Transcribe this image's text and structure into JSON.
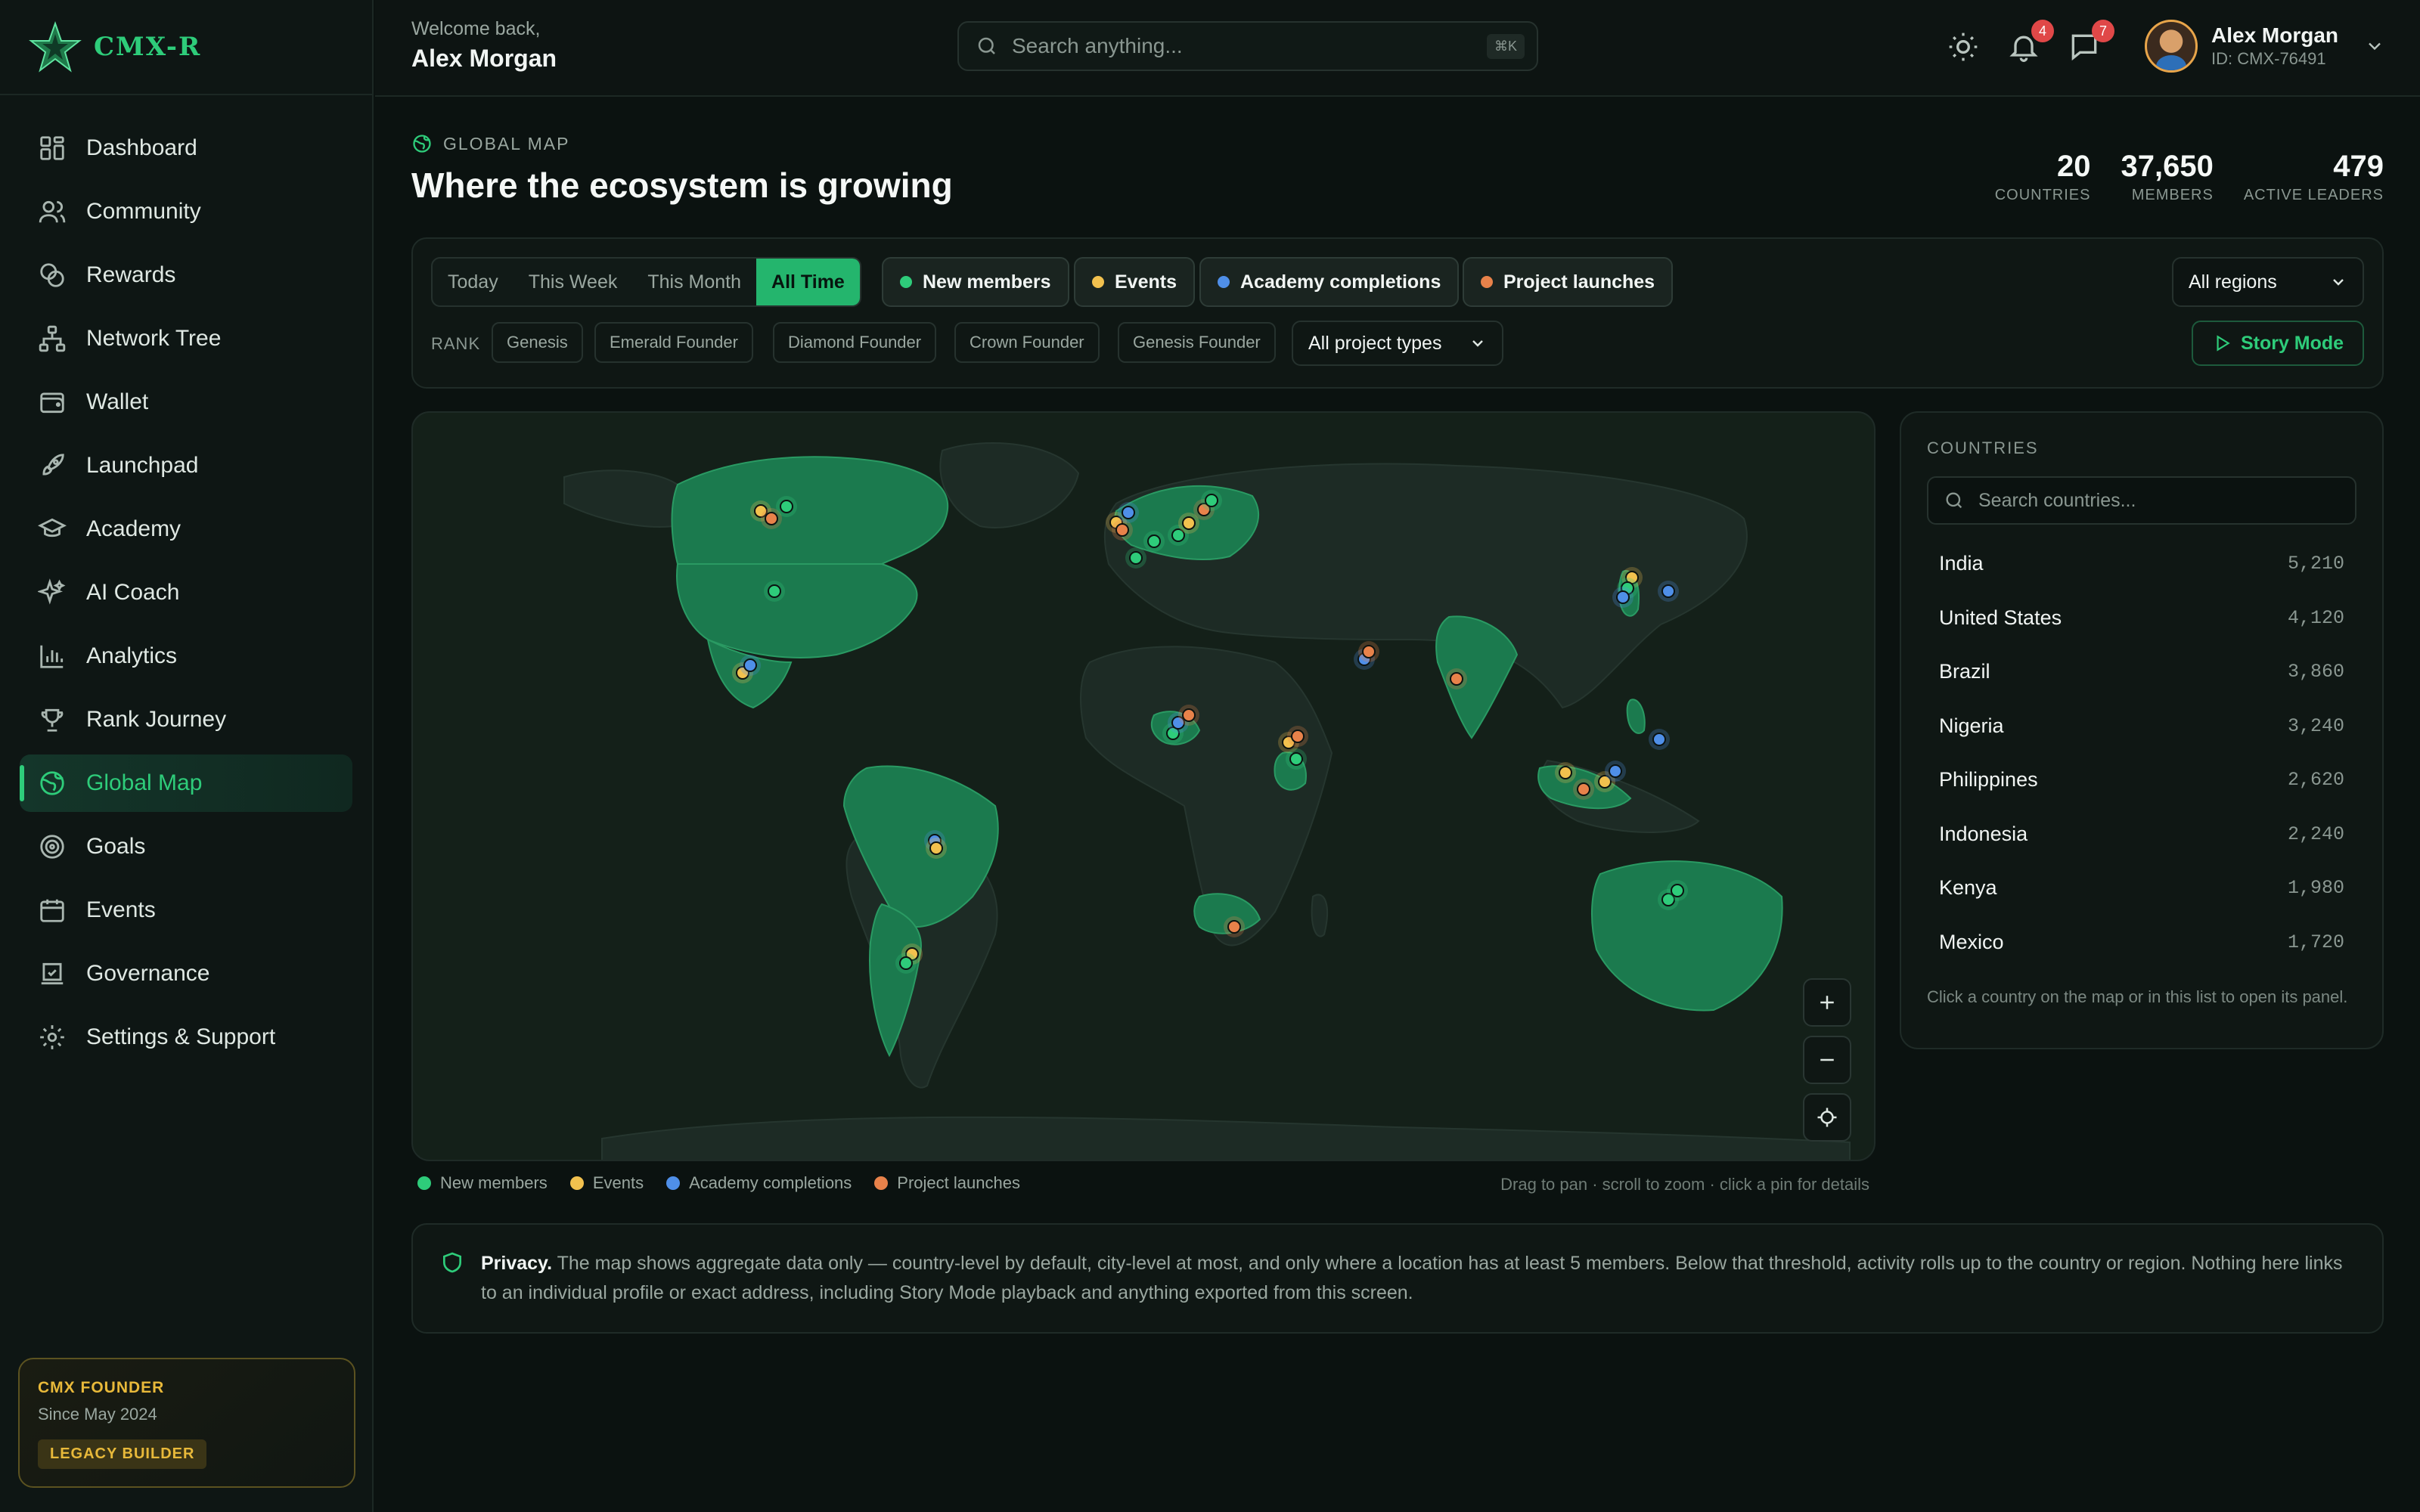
{
  "brand": {
    "name": "CMX-R",
    "accent": "#2ecc7a"
  },
  "header": {
    "welcome": "Welcome back,",
    "user_name": "Alex Morgan",
    "search_placeholder": "Search anything...",
    "search_shortcut": "⌘K",
    "notifications_count": "4",
    "messages_count": "7",
    "user_id": "ID: CMX-76491"
  },
  "sidebar": {
    "items": [
      {
        "label": "Dashboard",
        "icon": "dashboard-icon"
      },
      {
        "label": "Community",
        "icon": "users-icon"
      },
      {
        "label": "Rewards",
        "icon": "coins-icon"
      },
      {
        "label": "Network Tree",
        "icon": "network-icon"
      },
      {
        "label": "Wallet",
        "icon": "wallet-icon"
      },
      {
        "label": "Launchpad",
        "icon": "rocket-icon"
      },
      {
        "label": "Academy",
        "icon": "graduation-cap-icon"
      },
      {
        "label": "AI Coach",
        "icon": "sparkles-icon"
      },
      {
        "label": "Analytics",
        "icon": "bar-chart-icon"
      },
      {
        "label": "Rank Journey",
        "icon": "trophy-icon"
      },
      {
        "label": "Global Map",
        "icon": "globe-icon",
        "active": true
      },
      {
        "label": "Goals",
        "icon": "target-icon"
      },
      {
        "label": "Events",
        "icon": "calendar-icon"
      },
      {
        "label": "Governance",
        "icon": "vote-icon"
      },
      {
        "label": "Settings & Support",
        "icon": "gear-icon"
      }
    ],
    "founder": {
      "title": "CMX FOUNDER",
      "since": "Since May 2024",
      "badge": "LEGACY BUILDER"
    }
  },
  "page": {
    "tag": "GLOBAL MAP",
    "title": "Where the ecosystem is growing",
    "stats": [
      {
        "value": "20",
        "label": "COUNTRIES"
      },
      {
        "value": "37,650",
        "label": "MEMBERS"
      },
      {
        "value": "479",
        "label": "ACTIVE LEADERS"
      }
    ]
  },
  "filters": {
    "time_ranges": [
      "Today",
      "This Week",
      "This Month",
      "All Time"
    ],
    "selected_time": "All Time",
    "layers": [
      {
        "label": "New members",
        "color": "#2ecc7a"
      },
      {
        "label": "Events",
        "color": "#f2c14e"
      },
      {
        "label": "Academy completions",
        "color": "#4f8fe8"
      },
      {
        "label": "Project launches",
        "color": "#e8824a"
      }
    ],
    "region": "All regions",
    "rank_label": "RANK",
    "ranks": [
      "Genesis",
      "Emerald Founder",
      "Diamond Founder",
      "Crown Founder",
      "Genesis Founder"
    ],
    "project_type": "All project types",
    "story_mode": "Story Mode"
  },
  "map": {
    "hint": "Drag to pan · scroll to zoom · click a pin for details",
    "controls": [
      "zoom-in",
      "zoom-out",
      "recenter"
    ]
  },
  "countries": {
    "title": "COUNTRIES",
    "search_placeholder": "Search countries...",
    "list": [
      {
        "name": "India",
        "members": "5,210"
      },
      {
        "name": "United States",
        "members": "4,120"
      },
      {
        "name": "Brazil",
        "members": "3,860"
      },
      {
        "name": "Nigeria",
        "members": "3,240"
      },
      {
        "name": "Philippines",
        "members": "2,620"
      },
      {
        "name": "Indonesia",
        "members": "2,240"
      },
      {
        "name": "Kenya",
        "members": "1,980"
      },
      {
        "name": "Mexico",
        "members": "1,720"
      }
    ],
    "note": "Click a country on the map or in this list to open its panel."
  },
  "privacy": {
    "label": "Privacy.",
    "text": "The map shows aggregate data only — country-level by default, city-level at most, and only where a location has at least 5 members. Below that threshold, activity rolls up to the country or region. Nothing here links to an individual profile or exact address, including Story Mode playback and anything exported from this screen."
  }
}
